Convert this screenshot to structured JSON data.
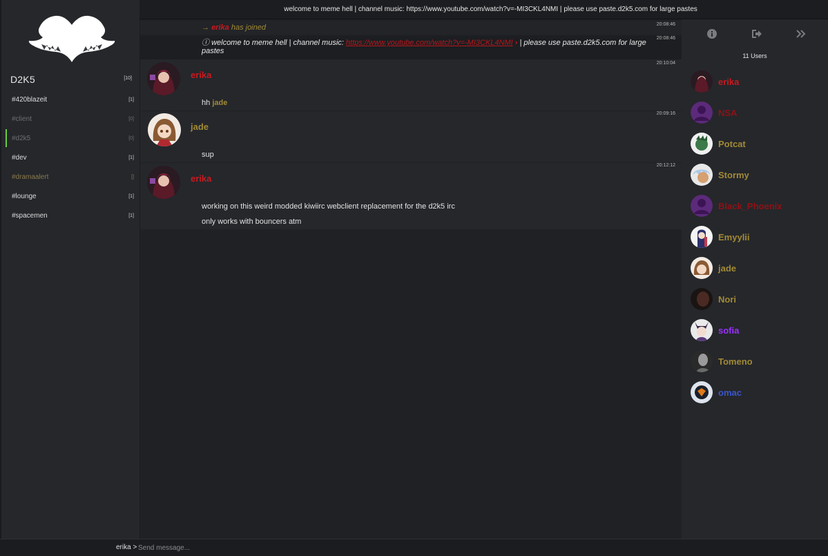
{
  "colors": {
    "erika": "#c8191f",
    "jade": "#a28a35",
    "purple": "#9b30ff",
    "blue": "#3d55c8"
  },
  "sidebar": {
    "network": {
      "name": "D2K5",
      "count": "[10]"
    },
    "channels": [
      {
        "name": "#420blazeit",
        "count": "[1]"
      },
      {
        "name": "#client",
        "count": "[0]"
      },
      {
        "name": "#d2k5",
        "count": "[0]"
      },
      {
        "name": "#dev",
        "count": "[1]"
      },
      {
        "name": "#dramaalert",
        "count": "[]"
      },
      {
        "name": "#lounge",
        "count": "[1]"
      },
      {
        "name": "#spacemen",
        "count": "[1]"
      }
    ]
  },
  "topic": "welcome to meme hell | channel music: https://www.youtube.com/watch?v=-MI3CKL4NMI | please use paste.d2k5.com for large pastes",
  "messages": {
    "join": {
      "arrow": "→",
      "nick": "erika",
      "text": "has joined",
      "time": "20:08:46"
    },
    "topic_notice": {
      "icon": "ⓘ",
      "prefix": "welcome to meme hell | channel music:",
      "link": "https://www.youtube.com/watch?v=-MI3CKL4NMI",
      "suffix": "| please use paste.d2k5.com for large pastes",
      "time": "20:08:46"
    },
    "m1": {
      "nick": "erika",
      "time": "20:10:04",
      "text": "hh",
      "mention": "jade"
    },
    "m2": {
      "nick": "jade",
      "time": "20:09:16",
      "text": "sup"
    },
    "m3": {
      "nick": "erika",
      "time": "20:12:12",
      "line1": "working on this weird modded kiwiirc webclient replacement for the d2k5 irc",
      "line2": "only works with bouncers atm"
    }
  },
  "userlist": {
    "count": "11 Users",
    "users": [
      {
        "name": "erika",
        "color": "#c8191f"
      },
      {
        "name": "NSA",
        "color": "#8e1216"
      },
      {
        "name": "Potcat",
        "color": "#a28a35"
      },
      {
        "name": "Stormy",
        "color": "#a28a35"
      },
      {
        "name": "Black_Phoenix",
        "color": "#8e1216"
      },
      {
        "name": "Emyylii",
        "color": "#a28a35"
      },
      {
        "name": "jade",
        "color": "#a28a35"
      },
      {
        "name": "Nori",
        "color": "#a28a35"
      },
      {
        "name": "sofia",
        "color": "#9b30ff"
      },
      {
        "name": "Tomeno",
        "color": "#a28a35"
      },
      {
        "name": "omac",
        "color": "#3d55c8"
      }
    ]
  },
  "input": {
    "prompt": "erika >",
    "placeholder": "Send message..."
  },
  "icons": {
    "info": "info-icon",
    "part": "exit-icon",
    "collapse": "double-chevron-icon"
  }
}
